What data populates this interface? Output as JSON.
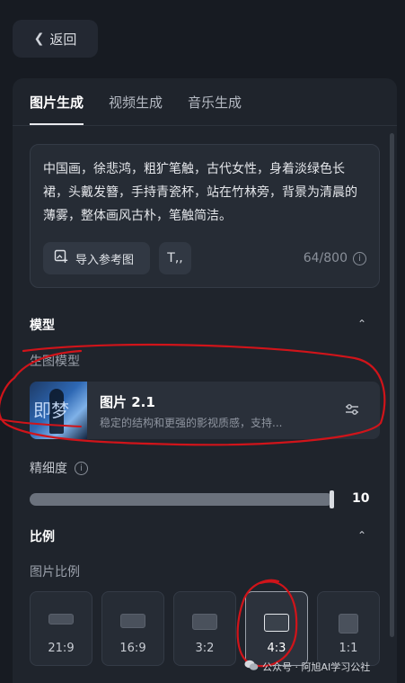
{
  "back_button": {
    "label": "返回"
  },
  "tabs": [
    {
      "label": "图片生成",
      "active": true
    },
    {
      "label": "视频生成",
      "active": false
    },
    {
      "label": "音乐生成",
      "active": false
    }
  ],
  "prompt": {
    "text": "中国画，徐悲鸿，粗犷笔触，古代女性，身着淡绿色长裙，头戴发簪，手持青瓷杯，站在竹林旁，背景为清晨的薄雾，整体画风古朴，笔触简洁。",
    "import_reference_label": "导入参考图",
    "text_style_label": "T,,",
    "char_count": "64/800"
  },
  "model_section": {
    "title": "模型",
    "sub_label": "生图模型",
    "model": {
      "name": "图片 2.1",
      "description": "稳定的结构和更强的影视质感，支持...",
      "thumb_text": "即梦"
    },
    "precision_label": "精细度",
    "precision_value": "10",
    "precision_fraction": 1.0
  },
  "ratio_section": {
    "title": "比例",
    "sub_label": "图片比例",
    "options": [
      {
        "label": "21:9",
        "selected": false
      },
      {
        "label": "16:9",
        "selected": false
      },
      {
        "label": "3:2",
        "selected": false
      },
      {
        "label": "4:3",
        "selected": true
      },
      {
        "label": "1:1",
        "selected": false
      }
    ]
  },
  "watermark": {
    "text": "公众号 · 阿旭AI学习公社"
  },
  "colors": {
    "background": "#171b22",
    "panel": "#1f242c",
    "annotation": "#d0141a"
  }
}
